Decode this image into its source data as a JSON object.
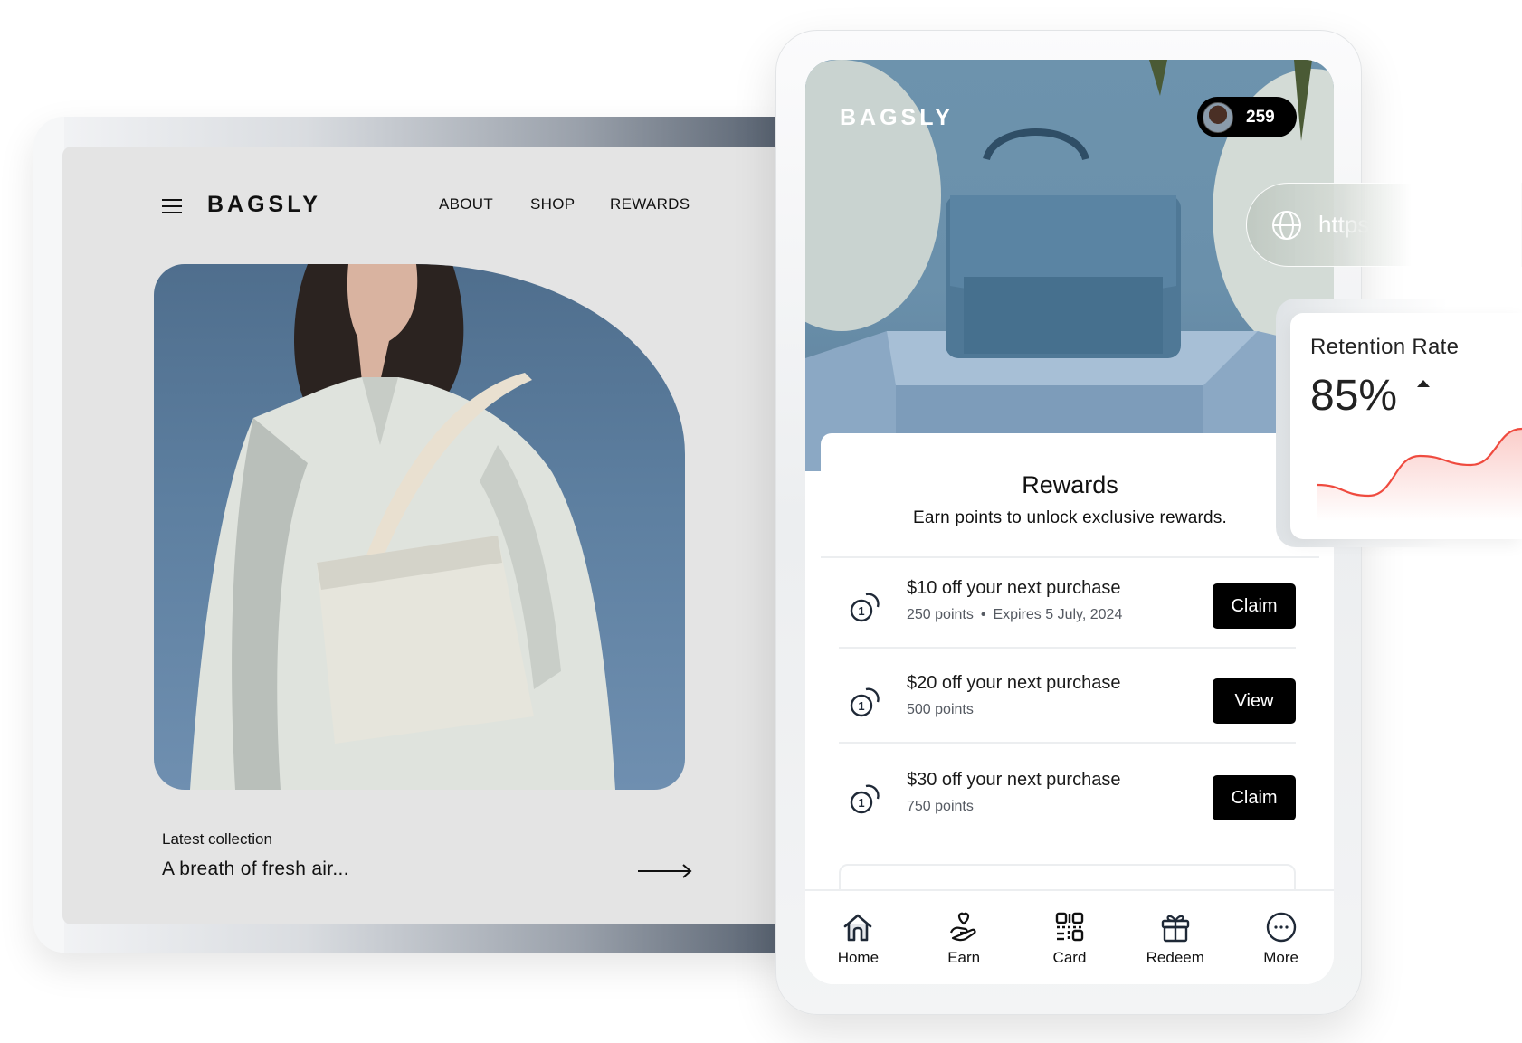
{
  "tablet": {
    "menu_icon": "hamburger-icon",
    "logo": "BAGSLY",
    "nav": [
      {
        "label": "ABOUT"
      },
      {
        "label": "SHOP"
      },
      {
        "label": "REWARDS"
      }
    ],
    "hero_image": "woman-with-white-shoulder-bag",
    "latest_label": "Latest collection",
    "latest_title": "A breath of fresh air...",
    "arrow_icon": "arrow-right-icon"
  },
  "phone": {
    "logo": "BAGSLY",
    "hero_image": "blue-handbag-on-pedestal",
    "points": "259",
    "rewards": {
      "title": "Rewards",
      "subtitle": "Earn points to unlock exclusive rewards.",
      "items": [
        {
          "title": "$10 off your next purchase",
          "points": "250 points",
          "separator": "•",
          "expires": "Expires 5 July, 2024",
          "action": "Claim"
        },
        {
          "title": "$20 off your next purchase",
          "points": "500 points",
          "action": "View"
        },
        {
          "title": "$30 off your next purchase",
          "points": "750 points",
          "action": "Claim"
        }
      ]
    },
    "bottom_nav": [
      {
        "label": "Home",
        "icon": "home-icon"
      },
      {
        "label": "Earn",
        "icon": "hand-heart-icon"
      },
      {
        "label": "Card",
        "icon": "qr-code-icon"
      },
      {
        "label": "Redeem",
        "icon": "gift-icon"
      },
      {
        "label": "More",
        "icon": "more-icon"
      }
    ]
  },
  "url_pill": {
    "icon": "globe-icon",
    "text": "https:"
  },
  "retention": {
    "title": "Retention Rate",
    "value": "85%",
    "trend": "up",
    "line_color": "#ef4b3f",
    "sparkline": [
      0.3,
      0.18,
      0.62,
      0.52,
      0.92
    ]
  }
}
